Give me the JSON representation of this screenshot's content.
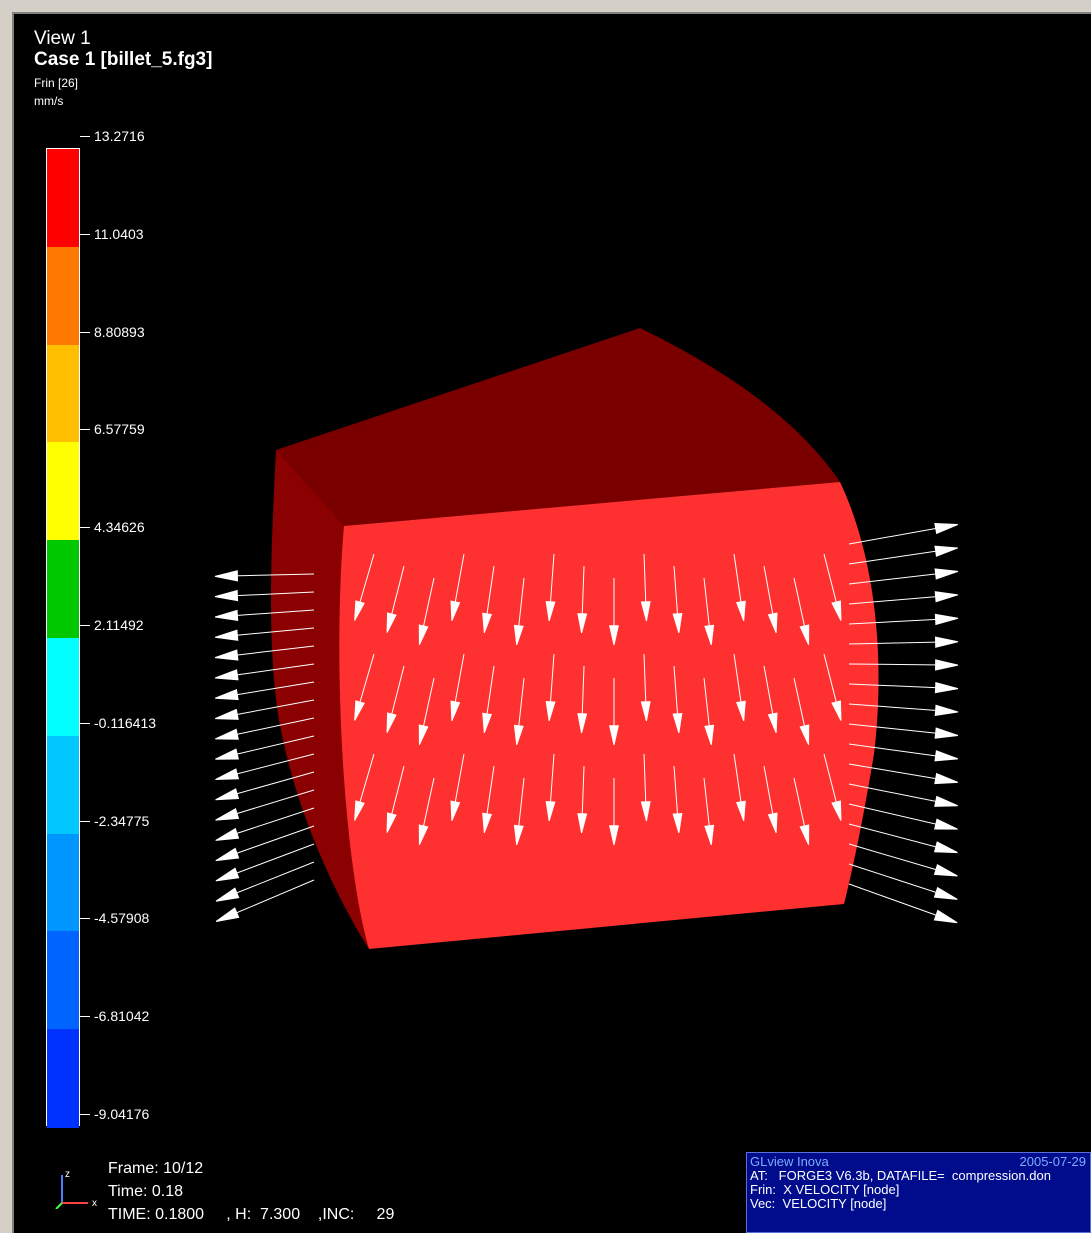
{
  "header": {
    "view_title": "View 1",
    "case_title": "Case 1  [billet_5.fg3]",
    "variable": "Frin [26]",
    "unit": "mm/s"
  },
  "legend": {
    "ticks": [
      "13.2716",
      "11.0403",
      "8.80893",
      "6.57759",
      "4.34626",
      "2.11492",
      "-0.116413",
      "-2.34775",
      "-4.57908",
      "-6.81042",
      "-9.04176"
    ],
    "band_colors": [
      "#ff0000",
      "#ff7800",
      "#ffbe00",
      "#ffff00",
      "#00c800",
      "#00ffff",
      "#00c8ff",
      "#0096ff",
      "#0064ff",
      "#0032ff",
      "#0000ff"
    ]
  },
  "footer": {
    "frame": "Frame: 10/12",
    "time": "Time: 0.18",
    "status_line": "TIME: 0.1800     , H:  7.300    ,INC:     29"
  },
  "axis": {
    "z_label": "z",
    "x_label": "x"
  },
  "glview": {
    "brand": "GLview Inova",
    "date": "2005-07-29",
    "line_at": "AT:   FORGE3 V6.3b, DATAFILE=  compression.don",
    "line_frin": "Frin:  X VELOCITY [node]",
    "line_vec": "Vec:  VELOCITY [node]"
  },
  "colors": {
    "billet_top": "#7a0000",
    "billet_front": "#ff3030",
    "billet_side": "#8b0000",
    "arrows": "#ffffff",
    "info_box": "#000c8c"
  }
}
